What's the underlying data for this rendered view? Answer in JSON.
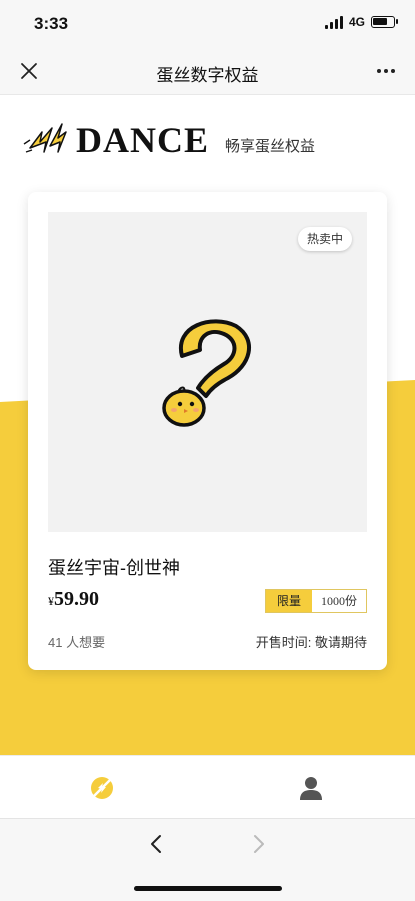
{
  "status": {
    "time": "3:33",
    "network": "4G",
    "icons": [
      "signal-icon",
      "battery-icon"
    ]
  },
  "navbar": {
    "title": "蛋丝数字权益",
    "close_icon": "close-icon",
    "more_icon": "more-dots-icon"
  },
  "brand": {
    "name": "DANCE",
    "tagline": "畅享蛋丝权益",
    "icon": "lightning-bolt-icon"
  },
  "product": {
    "badge": "热卖中",
    "title": "蛋丝宇宙-创世神",
    "currency": "¥",
    "price": "59.90",
    "limit_label": "限量",
    "limit_value": "1000份",
    "wants": "41 人想要",
    "sale_time": "开售时间: 敬请期待",
    "image_icon": "mystery-question-chick-icon"
  },
  "tabbar": {
    "items": [
      {
        "icon": "home-logo-icon",
        "active": true
      },
      {
        "icon": "profile-icon",
        "active": false
      }
    ]
  },
  "browser": {
    "back_icon": "chevron-left-icon",
    "forward_icon": "chevron-right-icon"
  },
  "colors": {
    "accent": "#f5cd3c",
    "background": "#ffffff",
    "text": "#222222"
  }
}
